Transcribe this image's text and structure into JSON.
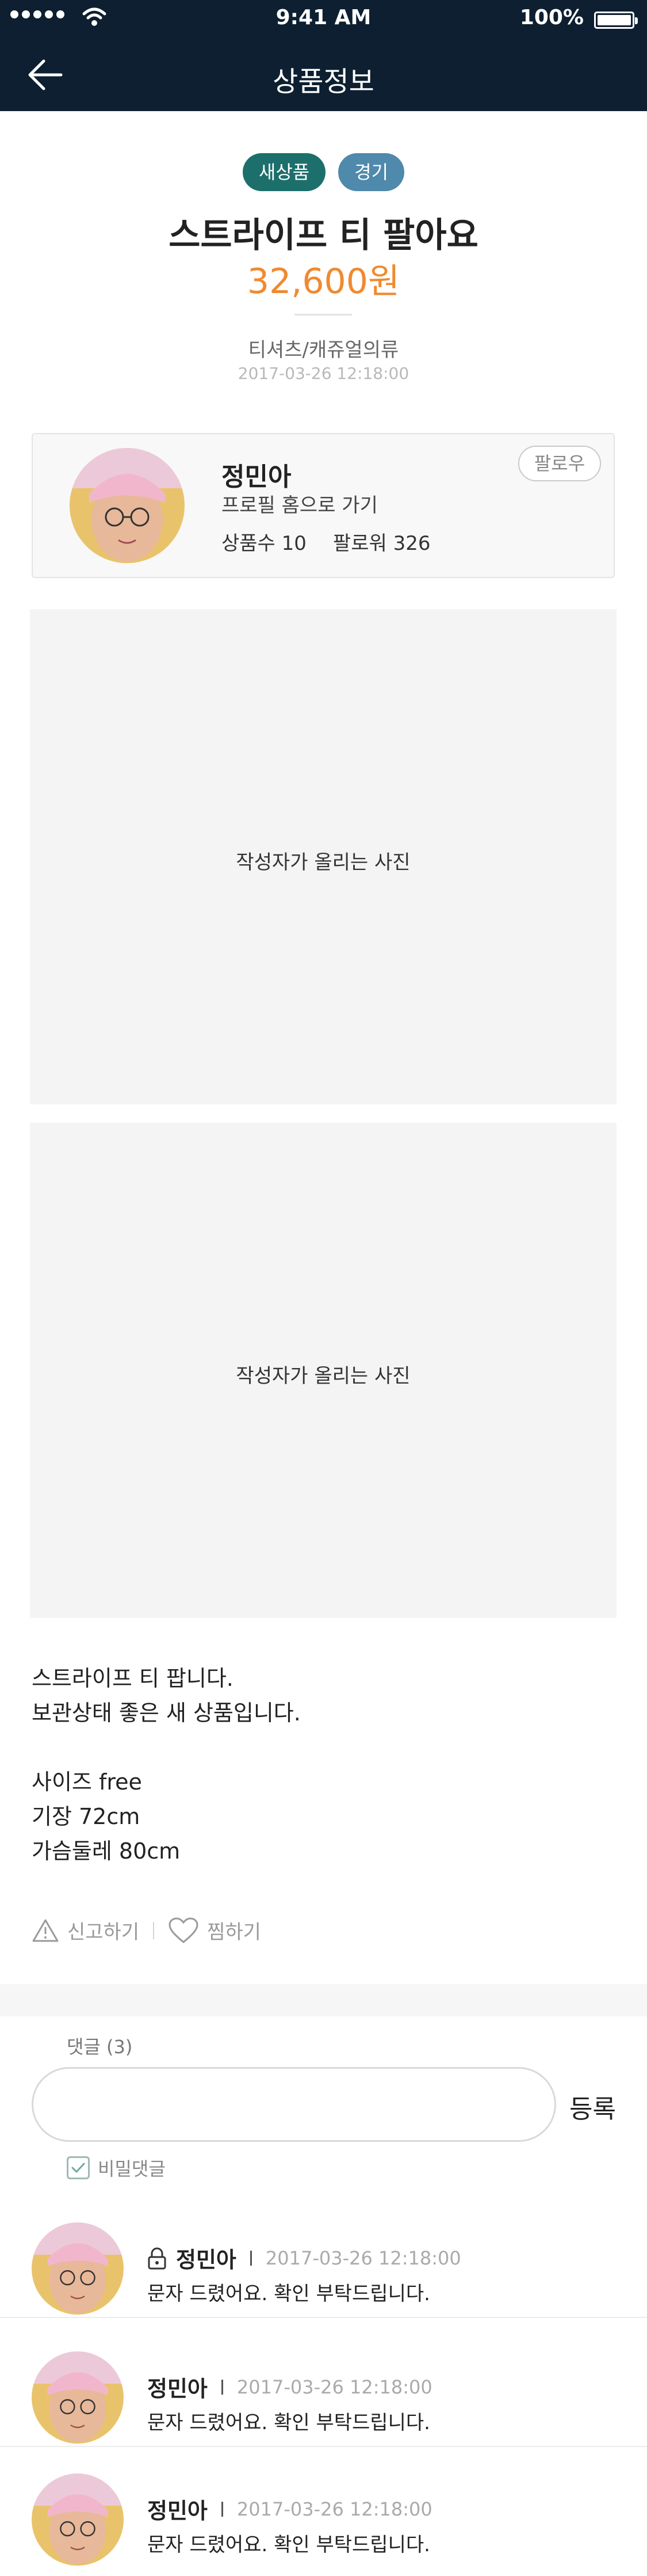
{
  "status_bar": {
    "time": "9:41 AM",
    "battery": "100%"
  },
  "header": {
    "title": "상품정보"
  },
  "product": {
    "tags": [
      "새상품",
      "경기"
    ],
    "title": "스트라이프 티 팔아요",
    "price": "32,600원",
    "category": "티셔츠/캐쥬얼의류",
    "date": "2017-03-26  12:18:00"
  },
  "seller": {
    "name": "정민아",
    "profile_link": "프로필 홈으로 가기",
    "products": "상품수 10",
    "followers": "팔로워 326",
    "follow_label": "팔로우"
  },
  "photos": {
    "caption_1": "작성자가 올리는 사진",
    "caption_2": "작성자가 올리는 사진"
  },
  "description": [
    "스트라이프 티 팝니다.",
    "보관상태 좋은 새 상품입니다.",
    "",
    "사이즈 free",
    "기장 72cm",
    "가슴둘레 80cm"
  ],
  "actions": {
    "report": "신고하기",
    "like": "찜하기"
  },
  "comments": {
    "count_label": "댓글 (3)",
    "input_value": "",
    "register_label": "등록",
    "secret_label": "비밀댓글",
    "items": [
      {
        "name": "정민아",
        "date": "2017-03-26  12:18:00",
        "text": "문자 드렸어요. 확인 부탁드립니다.",
        "locked": true
      },
      {
        "name": "정민아",
        "date": "2017-03-26  12:18:00",
        "text": "문자 드렸어요. 확인 부탁드립니다.",
        "locked": false
      },
      {
        "name": "정민아",
        "date": "2017-03-26  12:18:00",
        "text": "문자 드렸어요. 확인 부탁드립니다.",
        "locked": false
      }
    ]
  },
  "colors": {
    "header_bg": "#0d1f30",
    "price": "#f08a2f",
    "tag_new": "#1d6f6c",
    "tag_region": "#4f89ab"
  },
  "icons": [
    "back-arrow-icon",
    "warning-icon",
    "heart-icon",
    "lock-icon",
    "check-icon"
  ]
}
